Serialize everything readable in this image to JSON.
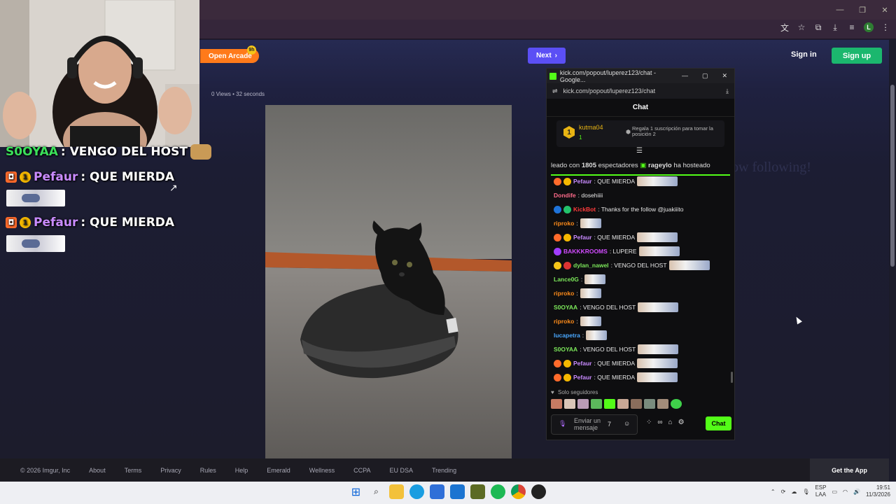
{
  "imgur": {
    "open_arcade": "Open Arcade",
    "arcade_badge": "9h",
    "next": "Next",
    "sign_in": "Sign in",
    "sign_up": "Sign up",
    "post_meta": "0 Views • 32 seconds",
    "now_following": "now following!"
  },
  "overlay_chat": [
    {
      "user": "S0OYAA",
      "text": ": VENGO DEL HOST",
      "color": "#3be05a"
    },
    {
      "user": "Pefaur",
      "text": ": QUE MIERDA",
      "color": "#c98bff"
    },
    {
      "user": "Pefaur",
      "text": ": QUE MIERDA",
      "color": "#c98bff"
    }
  ],
  "popout": {
    "window_title": "kick.com/popout/luperez123/chat - Google...",
    "url": "kick.com/popout/luperez123/chat",
    "chat_header": "Chat",
    "pinned_user": "kutma04",
    "pinned_count": "1",
    "pinned_text": "Regala 1 suscripción para tomar la posición 2",
    "host_prefix": "leado con",
    "host_count": "1805",
    "host_mid": "espectadores",
    "host_user": "rageylo",
    "host_suffix": "ha hosteado",
    "solo_seguidores": "Solo seguidores",
    "input_placeholder": "Enviar un mensaje",
    "chat_button": "Chat"
  },
  "messages": [
    {
      "user": "Pefaur",
      "color": "#c98bff",
      "text": ": QUE MIERDA",
      "emote": true,
      "badges": [
        "orange",
        "sub"
      ]
    },
    {
      "user": "Dondife",
      "color": "#ff6b8a",
      "text": ": dosehiiii",
      "emote": false,
      "badges": []
    },
    {
      "user": "KickBot",
      "color": "#ff3b3b",
      "text": ": Thanks for the follow @juakiiito",
      "emote": false,
      "badges": [
        "blue",
        "green"
      ]
    },
    {
      "user": "riproko",
      "color": "#ff8c1a",
      "text": ":",
      "emote": true,
      "badges": []
    },
    {
      "user": "Pefaur",
      "color": "#c98bff",
      "text": ": QUE MIERDA",
      "emote": true,
      "badges": [
        "orange",
        "sub"
      ]
    },
    {
      "user": "BAKKKROOMS",
      "color": "#d14bff",
      "text": ": LUPERE",
      "emote": true,
      "badges": [
        "purple"
      ]
    },
    {
      "user": "dylan_nawel",
      "color": "#7ce85a",
      "text": ": VENGO DEL HOST",
      "emote": true,
      "badges": [
        "yellow",
        "red"
      ]
    },
    {
      "user": "Lance0G",
      "color": "#7ce85a",
      "text": ":",
      "emote": true,
      "badges": []
    },
    {
      "user": "riproko",
      "color": "#ff8c1a",
      "text": ":",
      "emote": true,
      "badges": []
    },
    {
      "user": "S0OYAA",
      "color": "#7ce85a",
      "text": ": VENGO DEL HOST",
      "emote": true,
      "badges": []
    },
    {
      "user": "riproko",
      "color": "#ff8c1a",
      "text": ":",
      "emote": true,
      "badges": []
    },
    {
      "user": "lucapetra",
      "color": "#4aa8ff",
      "text": ":",
      "emote": true,
      "badges": []
    },
    {
      "user": "S0OYAA",
      "color": "#7ce85a",
      "text": ": VENGO DEL HOST",
      "emote": true,
      "badges": []
    },
    {
      "user": "Pefaur",
      "color": "#c98bff",
      "text": ": QUE MIERDA",
      "emote": true,
      "badges": [
        "orange",
        "sub"
      ]
    },
    {
      "user": "Pefaur",
      "color": "#c98bff",
      "text": ": QUE MIERDA",
      "emote": true,
      "badges": [
        "orange",
        "sub"
      ]
    }
  ],
  "footer": {
    "copyright": "© 2026 Imgur, Inc",
    "links": [
      "About",
      "Terms",
      "Privacy",
      "Rules",
      "Help",
      "Emerald",
      "Wellness",
      "CCPA",
      "EU DSA",
      "Trending"
    ],
    "get_app": "Get the App"
  },
  "taskbar": {
    "lang_top": "ESP",
    "lang_bottom": "LAA",
    "time": "19:51",
    "date": "11/3/2026"
  }
}
